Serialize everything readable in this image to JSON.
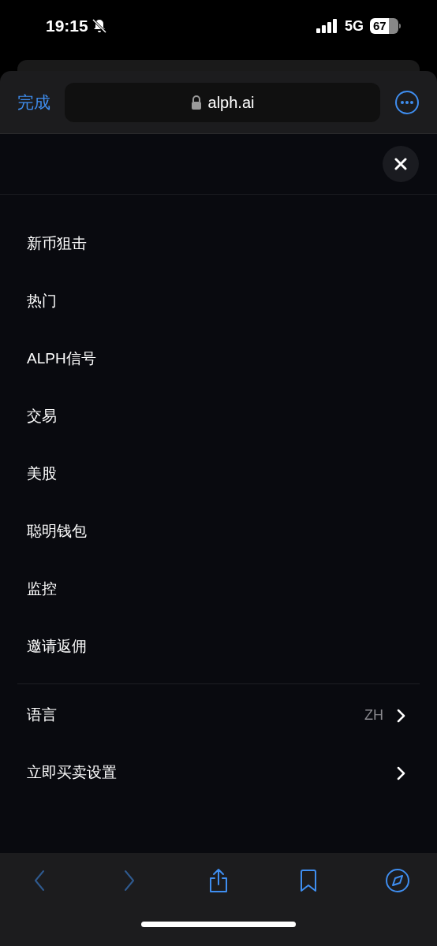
{
  "status_bar": {
    "time": "19:15",
    "network": "5G",
    "battery": "67"
  },
  "browser_toolbar": {
    "done": "完成",
    "url": "alph.ai"
  },
  "menu": {
    "items": [
      "新币狙击",
      "热门",
      "ALPH信号",
      "交易",
      "美股",
      "聪明钱包",
      "监控",
      "邀请返佣"
    ]
  },
  "settings": [
    {
      "label": "语言",
      "value": "ZH"
    },
    {
      "label": "立即买卖设置"
    }
  ],
  "bottom_bar": {
    "buttons": [
      {
        "kind": "back",
        "disabled": true
      },
      {
        "kind": "forward",
        "disabled": true
      },
      {
        "kind": "share",
        "disabled": false
      },
      {
        "kind": "bookmarks",
        "disabled": false
      },
      {
        "kind": "compass",
        "disabled": false
      }
    ]
  }
}
